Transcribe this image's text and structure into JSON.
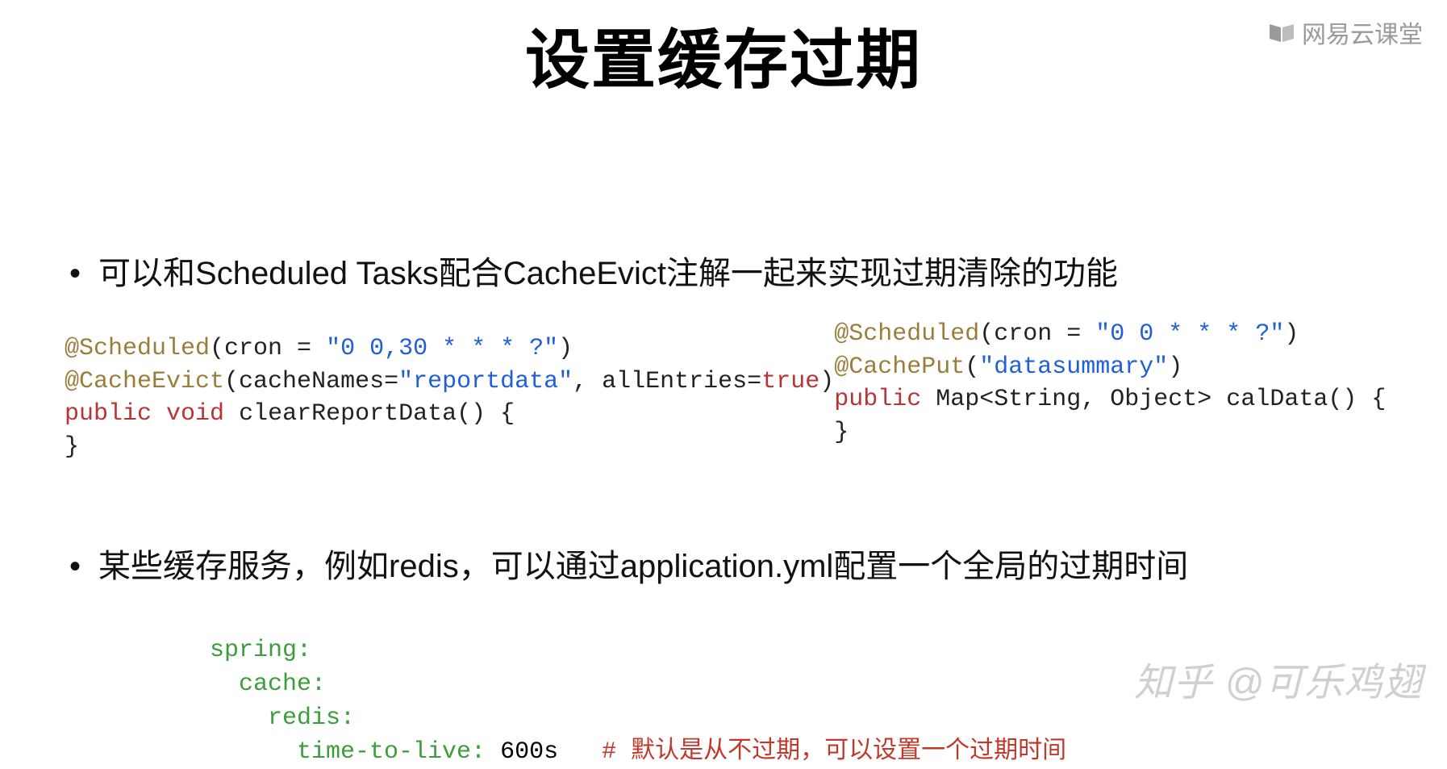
{
  "title": "设置缓存过期",
  "logo": {
    "text": "网易云课堂"
  },
  "bullets": {
    "b1": "可以和Scheduled Tasks配合CacheEvict注解一起来实现过期清除的功能",
    "b2": "某些缓存服务，例如redis，可以通过application.yml配置一个全局的过期时间"
  },
  "code_left": {
    "l1_attr": "@Scheduled",
    "l1_p1": "(cron = ",
    "l1_str": "\"0 0,30 * * * ?\"",
    "l1_p2": ")",
    "l2_attr": "@CacheEvict",
    "l2_p1": "(cacheNames=",
    "l2_str": "\"reportdata\"",
    "l2_p2": ", allEntries=",
    "l2_bool": "true",
    "l2_p3": ")",
    "l3_kw1": "public",
    "l3_kw2": "void",
    "l3_rest": " clearReportData() {",
    "l4": "}"
  },
  "code_right": {
    "l1_attr": "@Scheduled",
    "l1_p1": "(cron = ",
    "l1_str": "\"0 0 * * * ?\"",
    "l1_p2": ")",
    "l2_attr": "@CachePut",
    "l2_p1": "(",
    "l2_str": "\"datasummary\"",
    "l2_p2": ")",
    "l3_kw1": "public",
    "l3_rest": " Map<String, Object> calData() {",
    "l4": "}"
  },
  "yaml": {
    "l1": "spring:",
    "l2": "  cache:",
    "l3": "    redis:",
    "l4_key": "      time-to-live: ",
    "l4_val": "600s",
    "l4_sp": "   ",
    "l4_comment": "# 默认是从不过期，可以设置一个过期时间"
  },
  "watermark": "知乎 @可乐鸡翅"
}
